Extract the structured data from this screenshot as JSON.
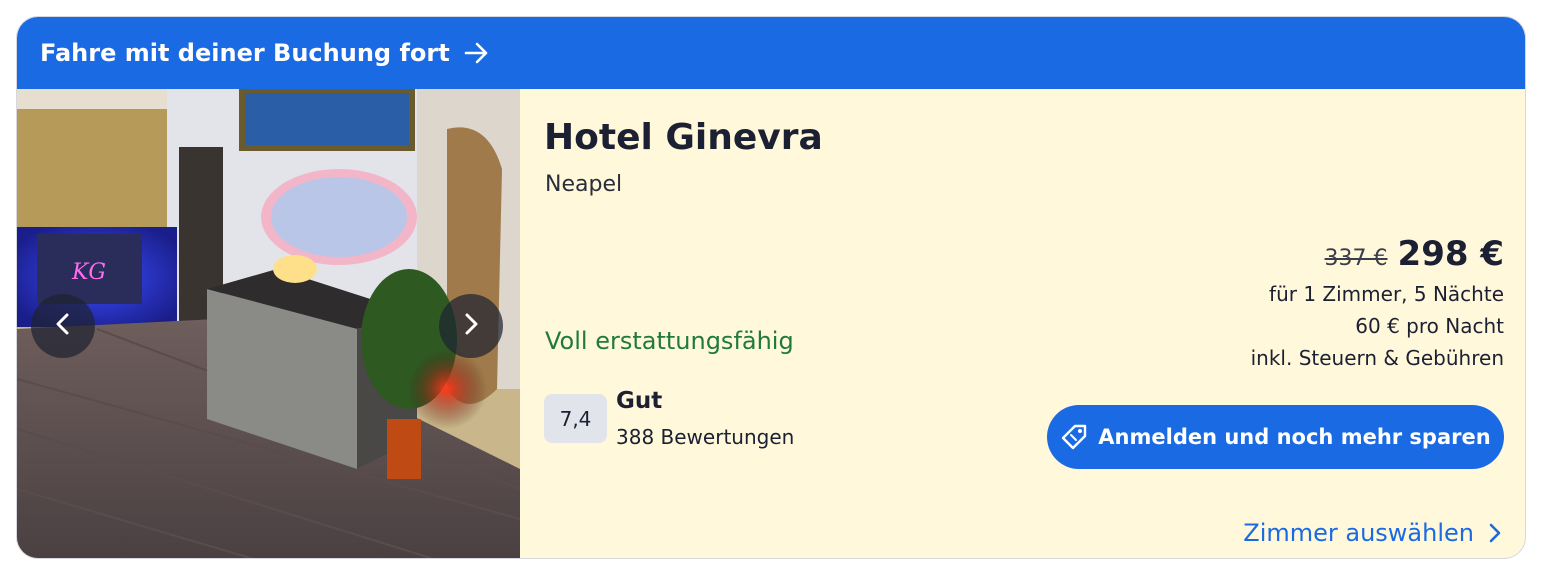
{
  "banner": {
    "text": "Fahre mit deiner Buchung fort",
    "icon": "arrow-right-icon"
  },
  "hotel": {
    "name": "Hotel Ginevra",
    "city": "Neapel",
    "refund": "Voll erstattungsfähig",
    "image_alt": "Hotel lobby photo"
  },
  "rating": {
    "score": "7,4",
    "label": "Gut",
    "reviews": "388 Bewertungen"
  },
  "price": {
    "old": "337 €",
    "new": "298 €",
    "details": [
      "für 1 Zimmer, 5 Nächte",
      "60 € pro Nacht",
      "inkl. Steuern & Gebühren"
    ]
  },
  "signin_button": {
    "label": "Anmelden und noch mehr sparen",
    "icon": "tag-icon"
  },
  "select_room": {
    "label": "Zimmer auswählen",
    "icon": "chevron-right-icon"
  },
  "carousel": {
    "prev_icon": "chevron-left-icon",
    "next_icon": "chevron-right-icon"
  },
  "colors": {
    "accent": "#1a6ae3",
    "card_bg": "#fff8da",
    "refund_green": "#207a3e"
  }
}
